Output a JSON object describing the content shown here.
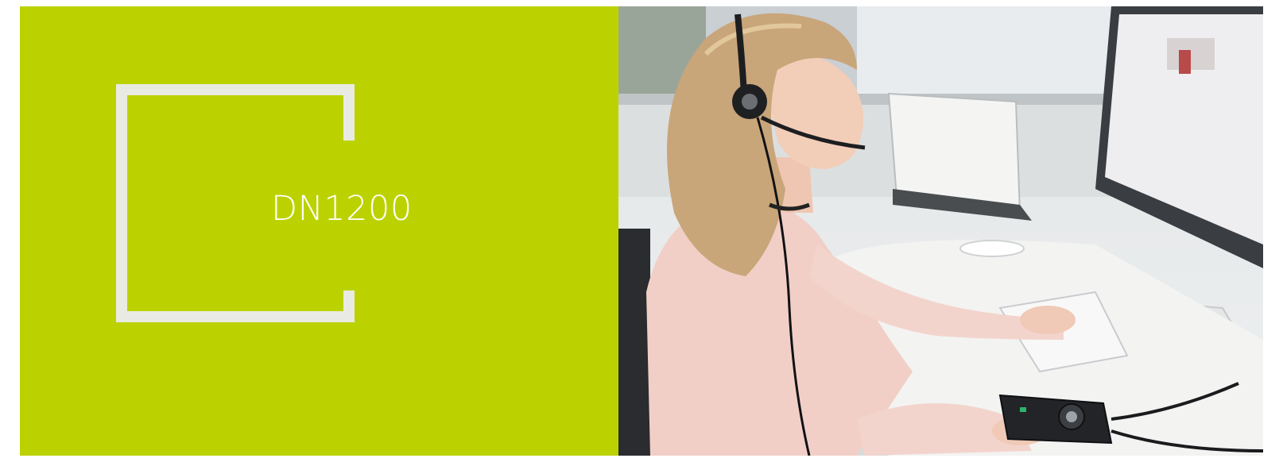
{
  "banner": {
    "model_name": "DN1200",
    "accent_color": "#bcd200",
    "frame_color": "#e9ebe2"
  },
  "photo": {
    "subject": "woman-with-headset-at-desk"
  }
}
